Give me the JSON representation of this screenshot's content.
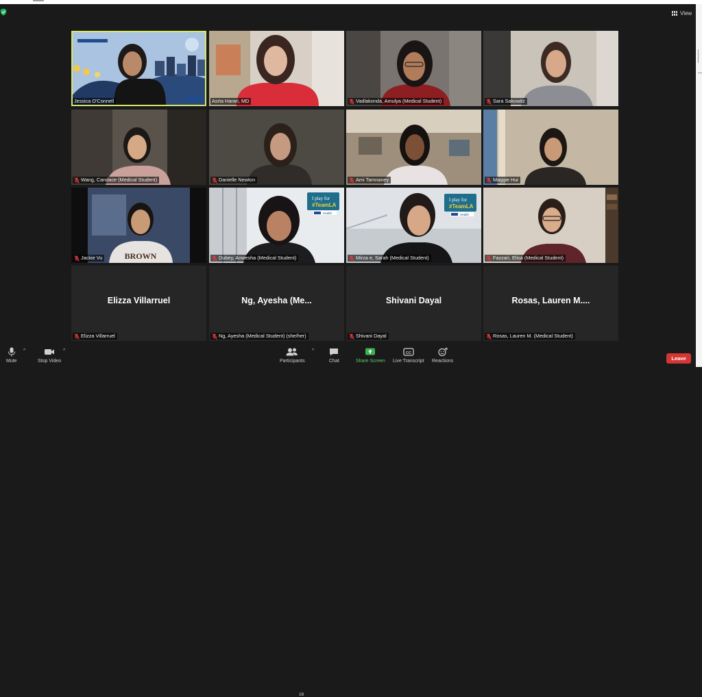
{
  "meeting": {
    "view_label": "View",
    "leave_label": "Leave"
  },
  "participants": [
    {
      "name": "Jessica O'Connell",
      "muted": false,
      "has_video": true,
      "active_speaker": true
    },
    {
      "name": "Asrta  Harari, MD",
      "muted": false,
      "has_video": true
    },
    {
      "name": "Vadlakonda, Amulya (Medical Student)",
      "muted": true,
      "has_video": true
    },
    {
      "name": "Sara Sakowitz",
      "muted": true,
      "has_video": true
    },
    {
      "name": "Wang, Candace (Medical Student)",
      "muted": true,
      "has_video": true
    },
    {
      "name": "Danielle Newton",
      "muted": true,
      "has_video": true
    },
    {
      "name": "Ami Tamnaney",
      "muted": true,
      "has_video": true
    },
    {
      "name": "Maggie Hui",
      "muted": true,
      "has_video": true
    },
    {
      "name": "Jackie Vu",
      "muted": true,
      "has_video": true,
      "shirt_text": "BROWN"
    },
    {
      "name": "Dubey, Anwesha (Medical Student)",
      "muted": true,
      "has_video": true,
      "badge": {
        "line1": "I play for",
        "line2": "#TeamLA",
        "logo": "Health"
      }
    },
    {
      "name": "Mirza e, Sarah (Medical Student)",
      "muted": true,
      "has_video": true,
      "badge": {
        "line1": "I play for",
        "line2": "#TeamLA",
        "logo": "Health"
      }
    },
    {
      "name": "Fazzari, Elisa (Medical Student)",
      "muted": true,
      "has_video": true
    },
    {
      "name": "Elizza Villarruel",
      "muted": true,
      "has_video": false,
      "display_name": "Elizza Villarruel"
    },
    {
      "name": "Ng, Ayesha (Medical Student) (she/her)",
      "muted": true,
      "has_video": false,
      "display_name": "Ng, Ayesha (Me..."
    },
    {
      "name": "Shivani Dayal",
      "muted": true,
      "has_video": false,
      "display_name": "Shivani Dayal"
    },
    {
      "name": "Rosas, Lauren M. (Medical Student)",
      "muted": true,
      "has_video": false,
      "display_name": "Rosas, Lauren M...."
    }
  ],
  "toolbar": {
    "mute": "Mute",
    "stop_video": "Stop Video",
    "participants": "Participants",
    "participants_count": "16",
    "chat": "Chat",
    "share_screen": "Share Screen",
    "live_transcript": "Live Transcript",
    "reactions": "Reactions"
  },
  "colors": {
    "background": "#1a1a1a",
    "active_speaker_border": "#d7e86a",
    "share_screen_green": "#5ecb69",
    "leave_red": "#d43733",
    "mic_off_red": "#e0393e"
  },
  "icons": {
    "security": "shield-check-icon",
    "view": "grid-icon",
    "mute": "microphone-icon",
    "stop_video": "video-camera-icon",
    "participants": "people-icon",
    "chat": "chat-bubble-icon",
    "share_screen": "share-screen-icon",
    "live_transcript": "closed-caption-icon",
    "reactions": "smiley-plus-icon",
    "muted": "mic-off-icon"
  }
}
